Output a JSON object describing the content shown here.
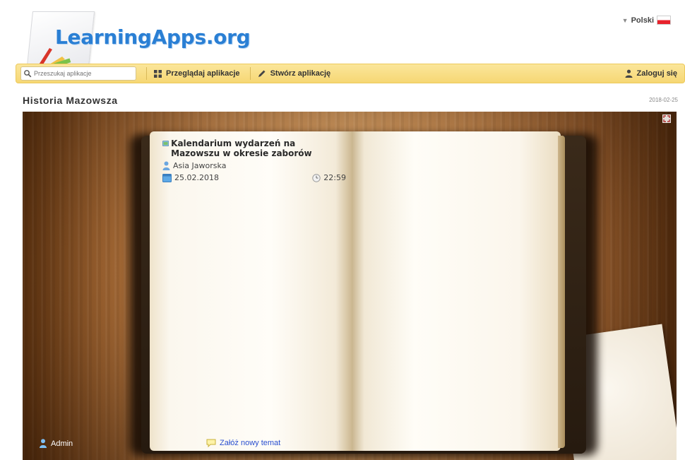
{
  "header": {
    "logo_text": "LearningApps.org",
    "language": "Polski"
  },
  "toolbar": {
    "search_placeholder": "Przeszukaj aplikacje",
    "browse_label": "Przeglądaj aplikacje",
    "create_label": "Stwórz aplikację",
    "login_label": "Zaloguj się"
  },
  "page": {
    "title": "Historia Mazowsza",
    "date": "2018-02-25"
  },
  "forum": {
    "topic": {
      "title": "Kalendarium wydarzeń na Mazowszu w okresie zaborów",
      "author": "Asia Jaworska",
      "date": "25.02.2018",
      "time": "22:59"
    },
    "admin_label": "Admin",
    "new_topic_label": "Załóż nowy temat"
  },
  "colors": {
    "logo": "#2a7fd4",
    "toolbar": "#f6d774",
    "link": "#2a4fd0"
  }
}
